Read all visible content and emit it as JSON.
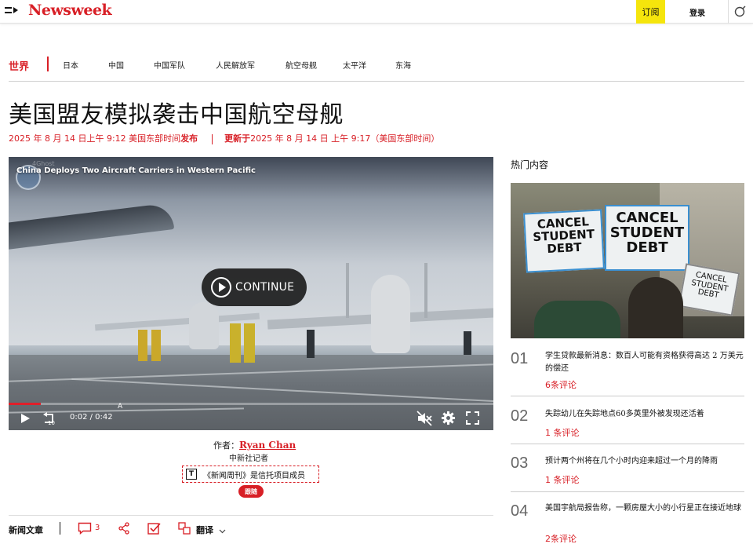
{
  "header": {
    "logo": "Newsweek",
    "subscribe_label": "订阅",
    "login_label": "登录"
  },
  "section_nav": {
    "section": "世界",
    "links": [
      "日本",
      "中国",
      "中国军队",
      "人民解放军",
      "航空母舰",
      "太平洋",
      "东海"
    ]
  },
  "article": {
    "headline": "美国盟友模拟袭击中国航空母舰",
    "published": "2025 年 8 月 14 日上午 9:12 美国东部时间",
    "published_suffix": "发布",
    "updated_prefix": "更新于",
    "updated": "2025 年 8 月 14 日 上午 9:17（美国东部时间）",
    "author_prefix": "作者：",
    "author_name": "Ryan Chan",
    "author_role": "中新社记者",
    "trust_icon_letter": "T",
    "trust_text": "《新闻周刊》是信托项目成员",
    "follow_label": "跟随"
  },
  "video": {
    "title": "China Deploys Two Aircraft Carriers in Western Pacific",
    "watermark": "4Ghost",
    "continue_label": "CONTINUE",
    "time": "0:02 / 0:42",
    "progress": 0.066,
    "rewind_seconds": "10",
    "cursor_label": "A"
  },
  "article_bar": {
    "label": "新闻文章",
    "comment_count": "3",
    "translate_label": "翻译"
  },
  "sidebar": {
    "title": "热门内容",
    "image_signs": [
      "CANCEL STUDENT DEBT",
      "CANCEL STUDENT DEBT",
      "CANCEL STUDENT DEBT"
    ],
    "items": [
      {
        "num": "01",
        "text": "学生贷款最新消息：数百人可能有资格获得高达 2 万美元的偿还",
        "comments": "6条评论"
      },
      {
        "num": "02",
        "text": "失踪幼儿在失踪地点60多英里外被发现还活着",
        "comments": "1 条评论"
      },
      {
        "num": "03",
        "text": "预计两个州将在几个小时内迎来超过一个月的降雨",
        "comments": "1 条评论"
      },
      {
        "num": "04",
        "text": "美国宇航局报告称，一颗房屋大小的小行星正在接近地球",
        "comments": "2条评论"
      }
    ]
  },
  "colors": {
    "brand_red": "#d81f26",
    "subscribe_yellow": "#f5e50c"
  }
}
